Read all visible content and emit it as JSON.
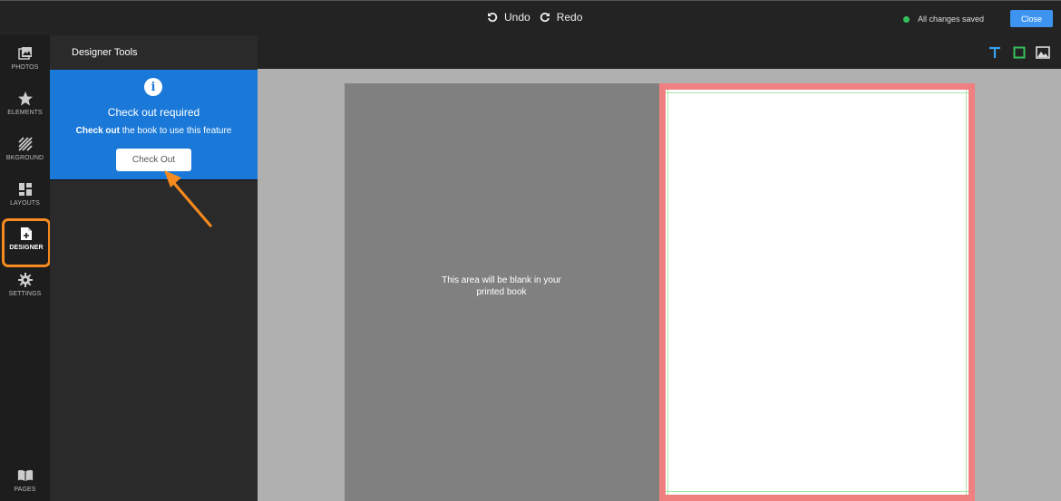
{
  "topbar": {
    "undo_label": "Undo",
    "redo_label": "Redo",
    "save_status": "All changes saved",
    "save_status_color": "#35c15a",
    "close_label": "Close"
  },
  "rail": {
    "items": [
      {
        "label": "PHOTOS",
        "icon": "photos-icon"
      },
      {
        "label": "ELEMENTS",
        "icon": "star-icon"
      },
      {
        "label": "BKGROUND",
        "icon": "background-icon"
      },
      {
        "label": "LAYOUTS",
        "icon": "layouts-icon"
      },
      {
        "label": "DESIGNER",
        "icon": "designer-icon",
        "active": true
      },
      {
        "label": "SETTINGS",
        "icon": "gear-icon"
      },
      {
        "label": "PAGES",
        "icon": "book-icon"
      }
    ]
  },
  "panel": {
    "title": "Designer Tools",
    "notice": {
      "heading": "Check out required",
      "sub_bold": "Check out",
      "sub_rest": " the book to use this feature",
      "button_label": "Check Out"
    }
  },
  "canvas": {
    "toolbar_icons": [
      "text-icon",
      "shape-icon",
      "image-icon"
    ],
    "left_page_message": "This area will be blank in your printed book"
  },
  "colors": {
    "accent_blue": "#3d94f0",
    "notice_blue": "#1a79d8",
    "highlight_orange": "#f58a1f",
    "selection_red": "#f08080"
  }
}
